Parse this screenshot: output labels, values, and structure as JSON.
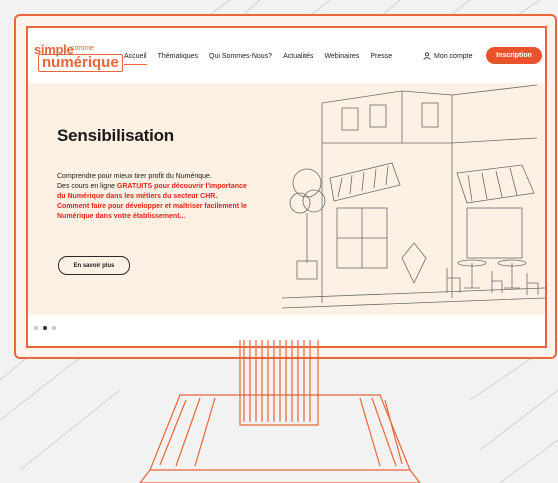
{
  "brand": {
    "logo_line1": "simple",
    "logo_line2": "comme",
    "logo_line3": "numérique",
    "accent_color": "#e8663a",
    "cta_color": "#e8532b",
    "hero_bg": "#fdf1e3"
  },
  "nav": {
    "items": [
      "Accueil",
      "Thématiques",
      "Qui Sommes-Nous?",
      "Actualités",
      "Webinaires",
      "Presse"
    ],
    "active": "Accueil"
  },
  "header": {
    "account_label": "Mon compte",
    "account_icon": "user-icon",
    "signup_label": "Inscription"
  },
  "hero": {
    "title": "Sensibilisation",
    "line1": "Comprendre pour mieux tirer profit du Numérique.",
    "line2_plain": "Des cours en ligne ",
    "line2_red": "GRATUITS pour découvrir l'importance du Numérique dans les métiers du secteur CHR.",
    "line3_red": "Comment faire pour développer et maîtriser facilement le Numérique dans votre établissement...",
    "cta_label": "En savoir plus",
    "illustration": "cafe-storefront-sketch"
  },
  "carousel": {
    "slide_count": 3,
    "active_index": 1
  }
}
